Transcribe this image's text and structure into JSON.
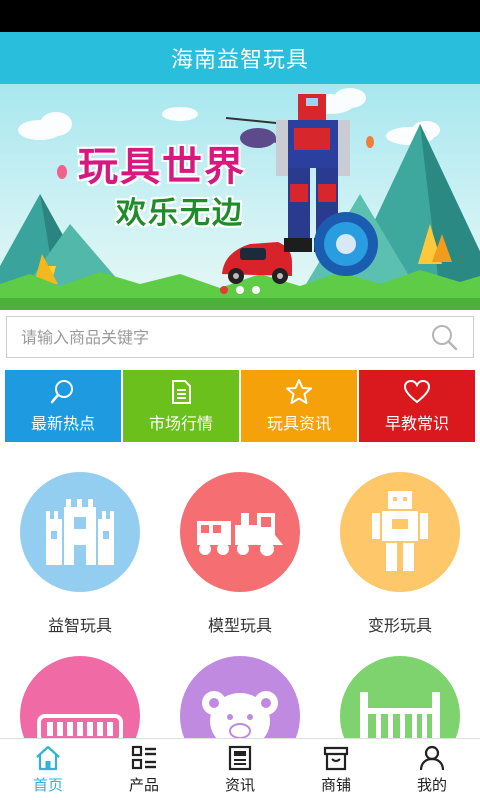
{
  "app": {
    "title": "海南益智玩具"
  },
  "banner": {
    "title": "玩具世界",
    "subtitle": "欢乐无边"
  },
  "search": {
    "placeholder": "请输入商品关键字"
  },
  "quick_links": [
    {
      "label": "最新热点",
      "color": "#1e9be0",
      "icon": "search-icon"
    },
    {
      "label": "市场行情",
      "color": "#6cc01b",
      "icon": "document-icon"
    },
    {
      "label": "玩具资讯",
      "color": "#f5a10a",
      "icon": "star-icon"
    },
    {
      "label": "早教常识",
      "color": "#d9191d",
      "icon": "heart-icon"
    }
  ],
  "categories": [
    {
      "label": "益智玩具",
      "color": "#93cdf0",
      "icon": "castle-icon"
    },
    {
      "label": "模型玩具",
      "color": "#f56f72",
      "icon": "train-icon"
    },
    {
      "label": "变形玩具",
      "color": "#fdc76a",
      "icon": "robot-icon"
    },
    {
      "label": "",
      "color": "#f06aa6",
      "icon": "xylophone-icon"
    },
    {
      "label": "",
      "color": "#c08ae0",
      "icon": "teddy-bear-icon"
    },
    {
      "label": "",
      "color": "#7fd36f",
      "icon": "crib-icon"
    }
  ],
  "tabs": [
    {
      "label": "首页",
      "icon": "home-icon",
      "active": true
    },
    {
      "label": "产品",
      "icon": "grid-list-icon"
    },
    {
      "label": "资讯",
      "icon": "news-icon"
    },
    {
      "label": "商铺",
      "icon": "shop-icon"
    },
    {
      "label": "我的",
      "icon": "user-icon"
    }
  ],
  "colors": {
    "accent": "#29bfdc",
    "tab_active": "#2fb5d4"
  }
}
